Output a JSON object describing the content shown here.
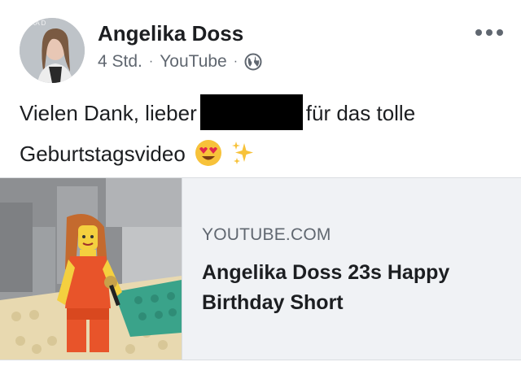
{
  "post": {
    "author": "Angelika Doss",
    "avatar_watermark": "ELIKA D",
    "time": "4 Std.",
    "via": "YouTube",
    "separator": "·",
    "audience_icon": "globe-icon",
    "more_icon": "more-dots-icon",
    "message": {
      "part1": "Vielen Dank, lieber",
      "part2": "für das tolle",
      "part3": "Geburtstagsvideo",
      "emojis": [
        "heart-eyes-emoji",
        "sparkles-emoji"
      ]
    }
  },
  "link_preview": {
    "domain": "YOUTUBE.COM",
    "title": "Angelika Doss 23s Happy Birthday Short",
    "thumbnail": "lego-minifigure-singing-image"
  },
  "colors": {
    "text_primary": "#1c1e21",
    "text_secondary": "#606770",
    "preview_bg": "#f0f2f5",
    "border": "#dadde1"
  }
}
